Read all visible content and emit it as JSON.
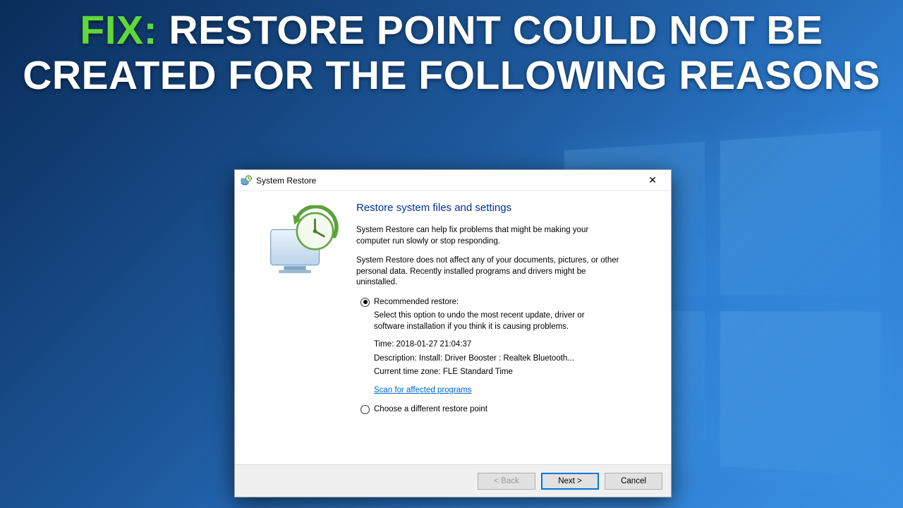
{
  "headline": {
    "prefix": "FIX:",
    "text": " RESTORE POINT COULD NOT BE CREATED FOR THE FOLLOWING REASONS"
  },
  "dialog": {
    "title": "System Restore",
    "close_glyph": "✕",
    "heading": "Restore system files and settings",
    "para1": "System Restore can help fix problems that might be making your computer run slowly or stop responding.",
    "para2": "System Restore does not affect any of your documents, pictures, or other personal data. Recently installed programs and drivers might be uninstalled.",
    "options": {
      "recommended": {
        "label": "Recommended restore:",
        "desc": "Select this option to undo the most recent update, driver or software installation if you think it is causing problems.",
        "time_label": "Time:",
        "time_value": "2018-01-27 21:04:37",
        "desc_label": "Description:",
        "desc_value": "Install: Driver Booster : Realtek Bluetooth...",
        "tz_label": "Current time zone:",
        "tz_value": "FLE Standard Time",
        "scan_link": "Scan for affected programs"
      },
      "choose": {
        "label": "Choose a different restore point"
      }
    },
    "buttons": {
      "back": "< Back",
      "next": "Next >",
      "cancel": "Cancel"
    }
  }
}
